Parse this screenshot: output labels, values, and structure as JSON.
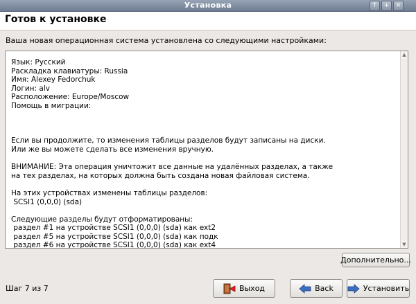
{
  "window": {
    "title": "Установка",
    "buttons": [
      "↑",
      "+",
      "×"
    ]
  },
  "header": {
    "title": "Готов к установке"
  },
  "description": "Ваша новая операционная система установлена со следующими настройками:",
  "summary_lines": [
    "Язык: Русский",
    "Раскладка клавиатуры: Russia",
    "Имя: Alexey Fedorchuk",
    "Логин: alv",
    "Расположение: Europe/Moscow",
    "Помощь в миграции:",
    "",
    "",
    "",
    "Если вы продолжите, то изменения таблицы разделов будут записаны на диски.",
    "Или же вы можете сделать все изменения вручную.",
    "",
    "ВНИМАНИЕ: Эта операция уничтожит все данные на удалённых разделах, а также",
    "на тех разделах, на которых должна быть создана новая файловая система.",
    "",
    "На этих устройствах изменены таблицы разделов:",
    " SCSI1 (0,0,0) (sda)",
    "",
    "Следующие разделы будут отформатированы:",
    " раздел #1 на устройстве SCSI1 (0,0,0) (sda) как ext2",
    " раздел #5 на устройстве SCSI1 (0,0,0) (sda) как подк",
    " раздел #6 на устройстве SCSI1 (0,0,0) (sda) как ext4"
  ],
  "buttons": {
    "advanced": "Дополнительно...",
    "quit": "Выход",
    "back": "Back",
    "install": "Установить"
  },
  "step_label": "Шаг 7 из 7",
  "icons": {
    "quit": "exit-door-icon",
    "back": "arrow-left-icon",
    "install": "arrow-right-icon"
  },
  "colors": {
    "titlebar": "#7f8ba0",
    "background": "#ebe8e5",
    "arrow_blue": "#3b6fc2"
  }
}
